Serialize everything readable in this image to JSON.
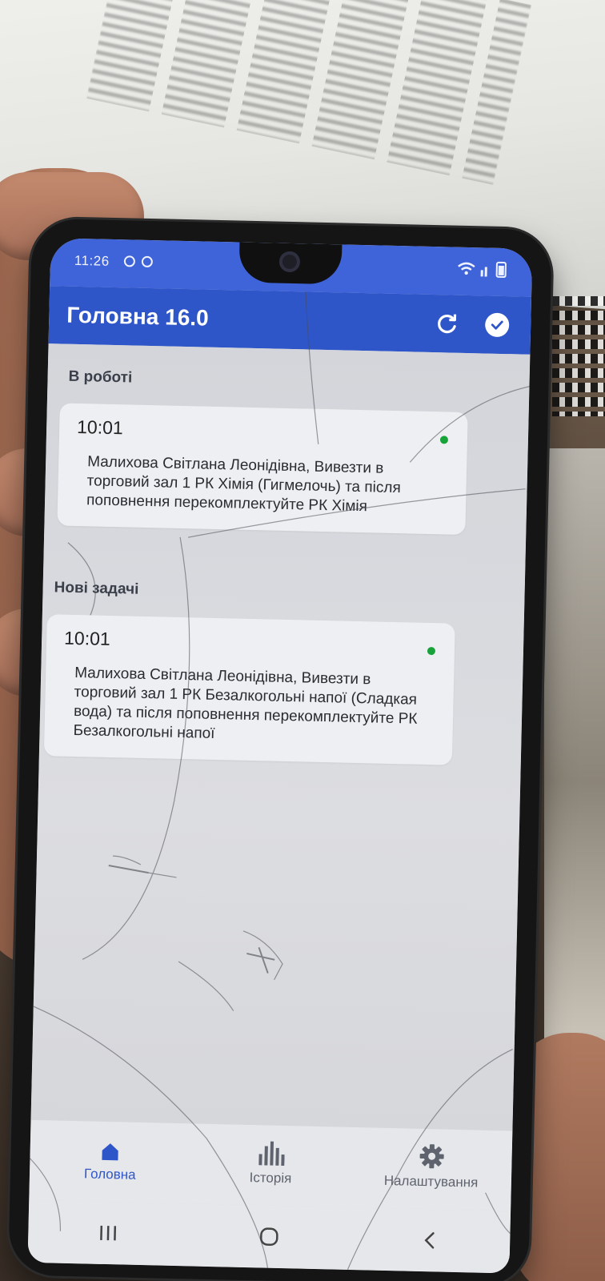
{
  "status_bar": {
    "time": "11:26"
  },
  "app_bar": {
    "title": "Головна 16.0",
    "refresh_icon": "refresh-icon",
    "check_icon": "check-circle-icon"
  },
  "sections": [
    {
      "title": "В роботі",
      "tasks": [
        {
          "time": "10:01",
          "text": "Малихова Світлана Леонідівна, Вивезти в торговий зал 1 РК Хімія (Гигмелочь) та після поповнення перекомплектуйте РК Хімія",
          "status_color": "#18a23a"
        }
      ]
    },
    {
      "title": "Нові задачі",
      "tasks": [
        {
          "time": "10:01",
          "text": "Малихова Світлана Леонідівна, Вивезти в торговий зал 1 РК Безалкогольні напої (Сладкая вода) та після поповнення перекомплектуйте РК Безалкогольні напої",
          "status_color": "#18a23a"
        }
      ]
    }
  ],
  "bottom_nav": {
    "home_label": "Головна",
    "history_label": "Історія",
    "settings_label": "Налаштування",
    "active_color": "#2f56c9"
  },
  "colors": {
    "app_bar": "#2f56c9",
    "status_bar": "#3f63d8"
  }
}
